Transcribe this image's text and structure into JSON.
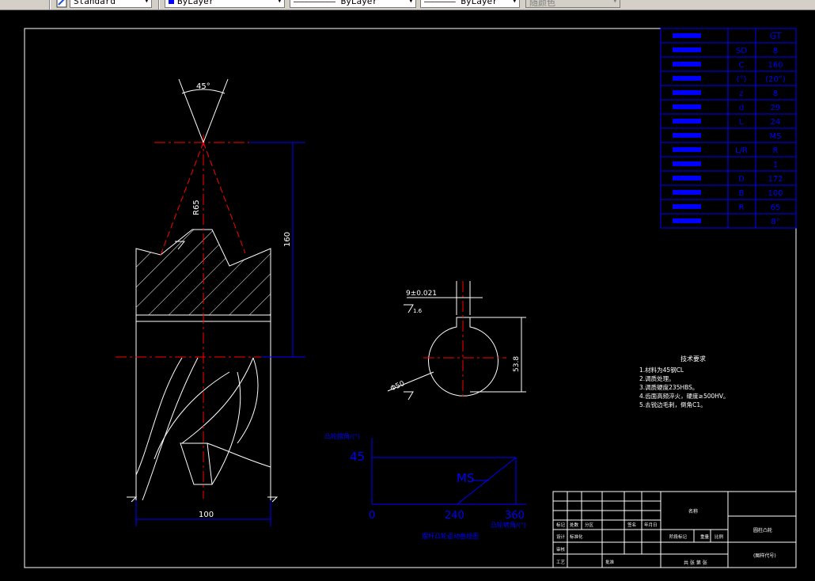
{
  "toolbar": {
    "text_style": "Standard",
    "layer_color": "ByLayer",
    "linetype": "ByLayer",
    "lineweight": "ByLayer",
    "plot_style": "随颜色"
  },
  "param_table": {
    "header_value": "GT",
    "rows": [
      {
        "symbol": "SD",
        "value": "8"
      },
      {
        "symbol": "C",
        "value": "160"
      },
      {
        "symbol": "(°)",
        "value": "(20°)"
      },
      {
        "symbol": "z",
        "value": "8"
      },
      {
        "symbol": "d",
        "value": "29"
      },
      {
        "symbol": "L",
        "value": "24"
      },
      {
        "symbol": "",
        "value": "MS"
      },
      {
        "symbol": "L/R",
        "value": "R"
      },
      {
        "symbol": "",
        "value": "1"
      },
      {
        "symbol": "D",
        "value": "172"
      },
      {
        "symbol": "B",
        "value": "100"
      },
      {
        "symbol": "R",
        "value": "65"
      },
      {
        "symbol": "",
        "value": "8°"
      }
    ]
  },
  "dims": {
    "angle": "45°",
    "radius": "R65",
    "height": "160",
    "width": "100",
    "key_width": "9±0.021",
    "key_depth": "53.8",
    "bore": "Φ50",
    "roughness": "1.6"
  },
  "tech_req": {
    "title": "技术要求",
    "items": [
      "1.材料为45钢CL",
      "2.调质处理。",
      "3.调质硬度235HBS。",
      "4.齿面高频淬火，硬度≥500HV。",
      "5.去锐边毛刺，倒角C1。"
    ]
  },
  "motion_chart": {
    "y_label": "凸轮摆角/(°)",
    "x_label": "凸轮转角/(°)",
    "caption": "摆杆凸轮运动曲线图",
    "segment_label": "MS",
    "y_value": "45",
    "x_ticks": [
      "0",
      "240",
      "360"
    ]
  },
  "title_block": {
    "name_cell": "名称",
    "part_name": "圆柱凸轮",
    "drawing_no": "(图样代号)",
    "scale_row": "共 张 第 张",
    "labels": [
      "标记",
      "处数",
      "分区",
      "签名",
      "年月日",
      "设计",
      "标准化",
      "阶段标记",
      "重量",
      "比例",
      "审核",
      "工艺",
      "批准"
    ]
  }
}
